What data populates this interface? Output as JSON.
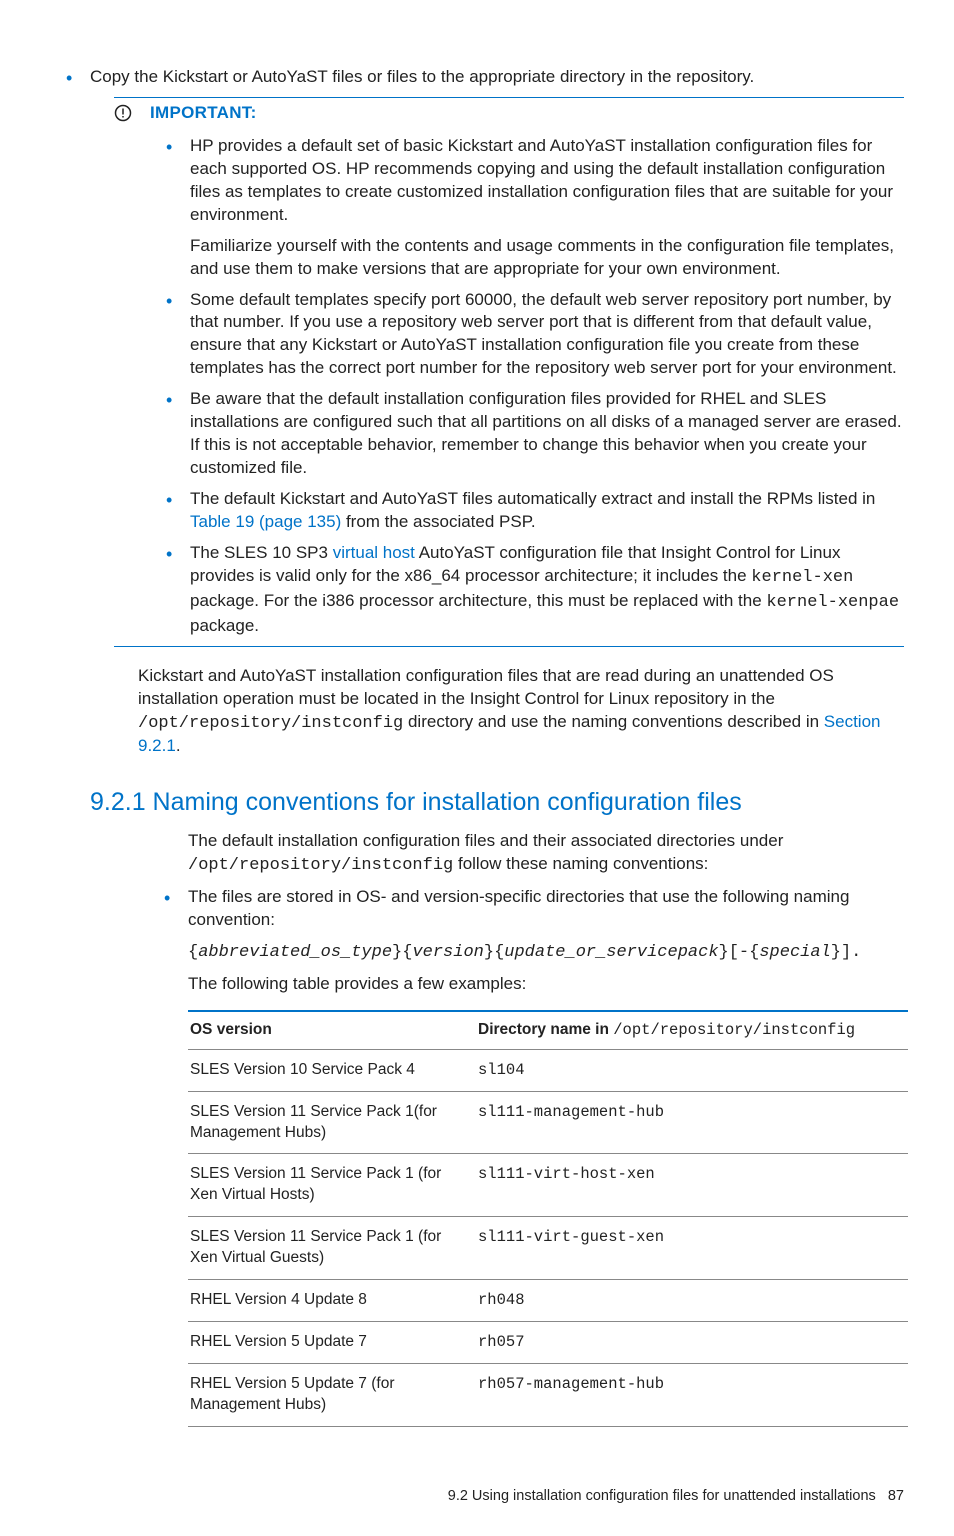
{
  "top_bullet": "Copy the Kickstart or AutoYaST files or files to the appropriate directory in the repository.",
  "important": {
    "label": "IMPORTANT:",
    "items": [
      {
        "paras": [
          "HP provides a default set of basic Kickstart and AutoYaST installation configuration files for each supported OS. HP recommends copying and using the default installation configuration files as templates to create customized installation configuration files that are suitable for your environment.",
          "Familiarize yourself with the contents and usage comments in the configuration file templates, and use them to make versions that are appropriate for your own environment."
        ]
      },
      {
        "paras": [
          "Some default templates specify port 60000, the default web server repository port number, by that number. If you use a repository web server port that is different from that default value, ensure that any Kickstart or AutoYaST installation configuration file you create from these templates has the correct port number for the repository web server port for your environment."
        ]
      },
      {
        "paras": [
          "Be aware that the default installation configuration files provided for RHEL and SLES installations are configured such that all partitions on all disks of a managed server are erased. If this is not acceptable behavior, remember to change this behavior when you create your customized file."
        ]
      },
      {
        "pre_link": "The default Kickstart and AutoYaST files automatically extract and install the RPMs listed in ",
        "link": "Table 19 (page 135)",
        "post_link": " from the associated PSP."
      },
      {
        "sles": {
          "t1": "The SLES 10 SP3 ",
          "vh": "virtual host",
          "t2": " AutoYaST configuration file that Insight Control for Linux provides is valid only for the x86_64 processor architecture; it includes the ",
          "code1": "kernel-xen",
          "t3": " package. For the i386 processor architecture, this must be replaced with the ",
          "code2": "kernel-xenpae",
          "t4": " package."
        }
      }
    ]
  },
  "after_notice": {
    "t1": "Kickstart and AutoYaST installation configuration files that are read during an unattended OS installation operation must be located in the Insight Control for Linux repository in the ",
    "code1": "/opt/repository/instconfig",
    "t2": " directory and use the naming conventions described in ",
    "link": "Section 9.2.1",
    "t3": "."
  },
  "section": {
    "title": "9.2.1 Naming conventions for installation configuration files",
    "intro_t1": "The default installation configuration files and their associated directories under ",
    "intro_code": "/opt/repository/instconfig",
    "intro_t2": " follow these naming conventions:",
    "bullet1": "The files are stored in OS- and version-specific directories that use the following naming convention:",
    "pattern": {
      "open": "{",
      "p1": "abbreviated_os_type",
      "mid1": "}{",
      "p2": "version",
      "mid2": "}{",
      "p3": "update_or_servicepack",
      "mid3": "}[-{",
      "p4": "special",
      "close": "}]."
    },
    "table_intro": "The following table provides a few examples:",
    "table_head_left": "OS version",
    "table_head_right_a": "Directory name in ",
    "table_head_right_b": "/opt/repository/instconfig",
    "rows": [
      {
        "os": "SLES Version 10 Service Pack 4",
        "dir": "sl104"
      },
      {
        "os": "SLES Version 11 Service Pack 1(for Management Hubs)",
        "dir": "sl111-management-hub"
      },
      {
        "os": "SLES Version 11 Service Pack 1 (for Xen Virtual Hosts)",
        "dir": "sl111-virt-host-xen"
      },
      {
        "os": "SLES Version 11 Service Pack 1 (for Xen Virtual Guests)",
        "dir": "sl111-virt-guest-xen"
      },
      {
        "os": "RHEL Version 4 Update 8",
        "dir": "rh048"
      },
      {
        "os": "RHEL Version 5 Update 7",
        "dir": "rh057"
      },
      {
        "os": "RHEL Version 5 Update 7 (for Management Hubs)",
        "dir": "rh057-management-hub"
      }
    ]
  },
  "footer": {
    "text": "9.2 Using installation configuration files for unattended installations",
    "page": "87"
  }
}
